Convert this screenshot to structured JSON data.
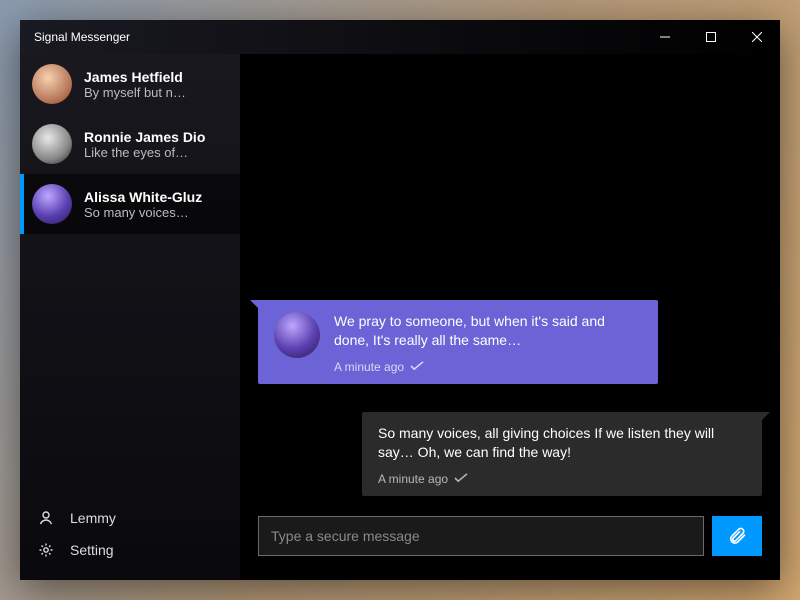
{
  "window": {
    "title": "Signal Messenger"
  },
  "buttons": {
    "minimize": "minimize",
    "maximize": "maximize",
    "close": "close"
  },
  "contacts": [
    {
      "name": "James Hetfield",
      "preview": "By myself but n…"
    },
    {
      "name": "Ronnie James Dio",
      "preview": "Like the eyes of…"
    },
    {
      "name": "Alissa White-Gluz",
      "preview": "So many voices…",
      "selected": true
    }
  ],
  "sidebar": {
    "profile_label": "Lemmy",
    "settings_label": "Setting"
  },
  "messages": [
    {
      "side": "left",
      "text": "We pray to someone, but when it's said and done, It's really all the same…",
      "time": "A minute ago"
    },
    {
      "side": "right",
      "text": "So many voices, all giving choices If we listen they will say… Oh, we can find the way!",
      "time": "A minute ago"
    }
  ],
  "compose": {
    "placeholder": "Type a secure message",
    "value": ""
  },
  "icons": {
    "attach": "attachment-icon",
    "person": "person-icon",
    "gear": "gear-icon",
    "check": "check-icon"
  },
  "colors": {
    "accent_purple": "#6b63d6",
    "accent_blue": "#0099ff"
  }
}
